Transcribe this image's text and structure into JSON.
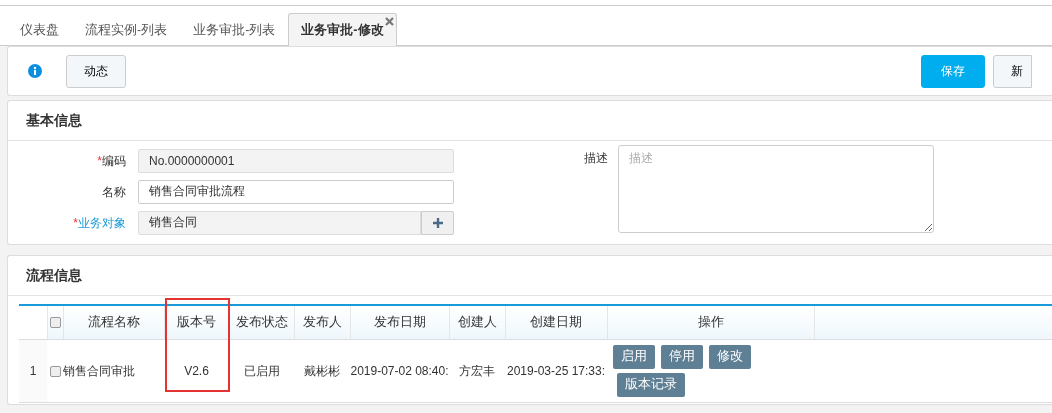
{
  "tabs": [
    {
      "label": "仪表盘",
      "selected": false,
      "closable": false
    },
    {
      "label": "流程实例-列表",
      "selected": false,
      "closable": false
    },
    {
      "label": "业务审批-列表",
      "selected": false,
      "closable": false
    },
    {
      "label": "业务审批-修改",
      "selected": true,
      "closable": true
    }
  ],
  "toolbar": {
    "left_buttons": [
      "动态"
    ],
    "right_buttons": [
      {
        "label": "保存",
        "primary": true
      },
      {
        "label": "新",
        "primary": false
      }
    ]
  },
  "basic_info": {
    "title": "基本信息",
    "fields": [
      {
        "label": "编码",
        "required_mark": "*",
        "link": false,
        "value": "No.0000000001",
        "readonly": true,
        "addon": false
      },
      {
        "label": "名称",
        "link": false,
        "value": "销售合同审批流程",
        "readonly": false,
        "addon": false
      },
      {
        "label": "业务对象",
        "required_mark": "*",
        "link": true,
        "value": "销售合同",
        "readonly": true,
        "addon": true
      }
    ],
    "description": {
      "label": "描述",
      "placeholder": "描述"
    }
  },
  "flow_info": {
    "title": "流程信息",
    "table": {
      "columns": [
        {
          "kind": "index",
          "highlighted": false
        },
        {
          "kind": "checkbox",
          "highlighted": false
        },
        {
          "label": "流程名称",
          "highlighted": false
        },
        {
          "label": "版本号",
          "highlighted": true
        },
        {
          "label": "发布状态",
          "highlighted": false
        },
        {
          "label": "发布人",
          "highlighted": false
        },
        {
          "label": "发布日期",
          "highlighted": false
        },
        {
          "label": "创建人",
          "highlighted": false
        },
        {
          "label": "创建日期",
          "highlighted": false
        },
        {
          "label": "操作",
          "highlighted": false
        }
      ],
      "header_checked": false,
      "rows": [
        {
          "index": "1",
          "checked": false,
          "name": "销售合同审批",
          "version": "V2.6",
          "status": "已启用",
          "publisher": "戴彬彬",
          "publish_date": "2019-07-02 08:40:",
          "creator": "方宏丰",
          "create_date": "2019-03-25 17:33:",
          "actions": [
            "启用",
            "停用",
            "修改",
            "版本记录"
          ]
        }
      ]
    }
  }
}
